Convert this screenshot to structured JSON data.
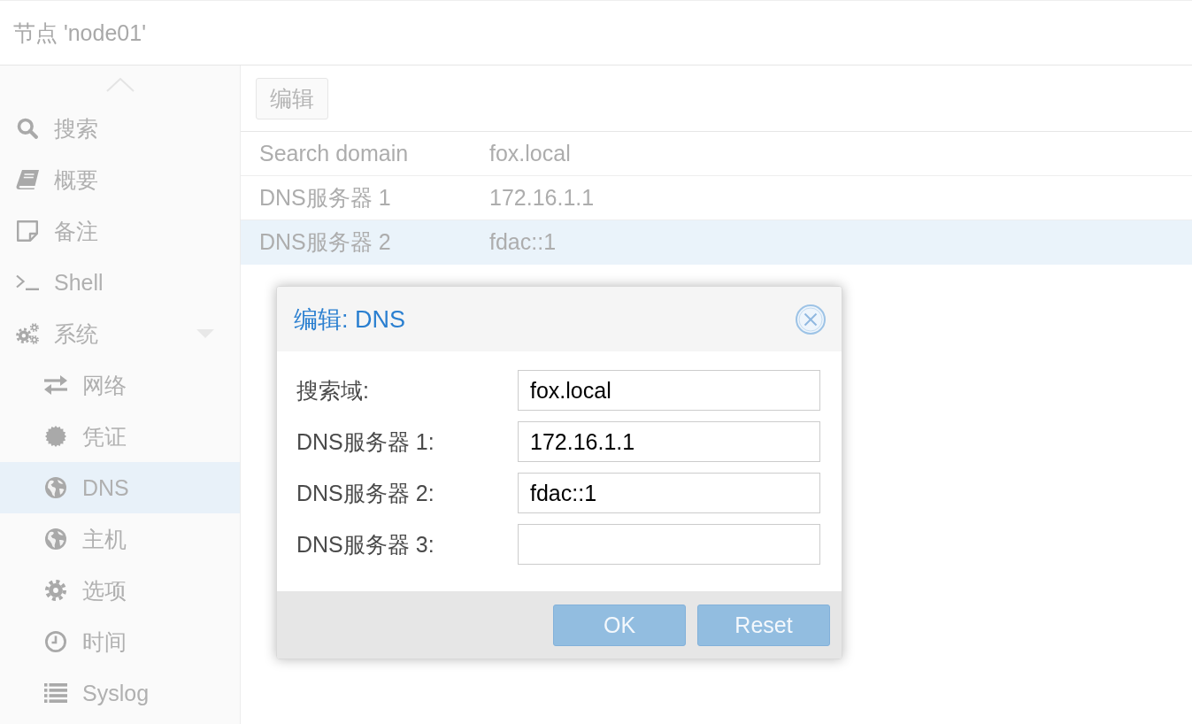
{
  "header": {
    "title": "节点 'node01'"
  },
  "sidebar": {
    "items": [
      {
        "label": "搜索",
        "selected": false
      },
      {
        "label": "概要",
        "selected": false
      },
      {
        "label": "备注",
        "selected": false
      },
      {
        "label": "Shell",
        "selected": false
      },
      {
        "label": "系统",
        "selected": false,
        "expanded": true,
        "children": [
          {
            "label": "网络",
            "selected": false
          },
          {
            "label": "凭证",
            "selected": false
          },
          {
            "label": "DNS",
            "selected": true
          },
          {
            "label": "主机",
            "selected": false
          },
          {
            "label": "选项",
            "selected": false
          },
          {
            "label": "时间",
            "selected": false
          },
          {
            "label": "Syslog",
            "selected": false
          }
        ]
      }
    ]
  },
  "toolbar": {
    "buttons": [
      "编辑"
    ]
  },
  "table": {
    "rows": [
      {
        "cells": [
          "Search domain",
          "fox.local"
        ],
        "selected": false
      },
      {
        "cells": [
          "DNS服务器 1",
          "172.16.1.1"
        ],
        "selected": false
      },
      {
        "cells": [
          "DNS服务器 2",
          "fdac::1"
        ],
        "selected": true
      }
    ]
  },
  "dialog": {
    "title": "编辑: DNS",
    "fields": [
      {
        "label": "搜索域:",
        "value": "fox.local"
      },
      {
        "label": "DNS服务器 1:",
        "value": "172.16.1.1"
      },
      {
        "label": "DNS服务器 2:",
        "value": "fdac::1"
      },
      {
        "label": "DNS服务器 3:"
      }
    ],
    "buttons": [
      {
        "label": "OK",
        "disabled": true
      },
      {
        "label": "Reset",
        "disabled": true
      }
    ]
  }
}
